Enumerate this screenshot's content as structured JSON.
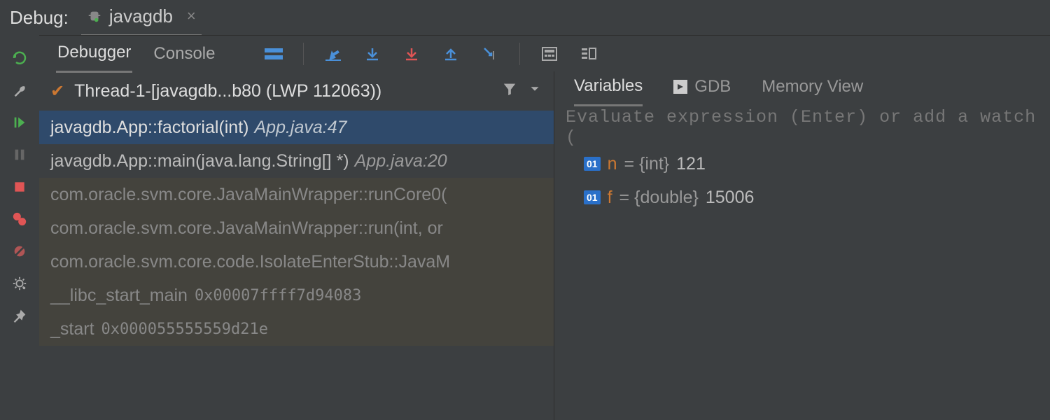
{
  "header": {
    "label": "Debug:",
    "run_config": "javagdb"
  },
  "tabs": {
    "debugger": "Debugger",
    "console": "Console"
  },
  "thread": {
    "text": "Thread-1-[javagdb...b80 (LWP 112063))"
  },
  "frames": [
    {
      "fn": "javagdb.App::factorial(int)",
      "loc": "App.java:47",
      "selected": true,
      "lib": false
    },
    {
      "fn": "javagdb.App::main(java.lang.String[] *)",
      "loc": "App.java:20",
      "selected": false,
      "lib": false
    },
    {
      "fn": "com.oracle.svm.core.JavaMainWrapper::runCore0(",
      "loc": "",
      "selected": false,
      "lib": true
    },
    {
      "fn": "com.oracle.svm.core.JavaMainWrapper::run(int, or",
      "loc": "",
      "selected": false,
      "lib": true
    },
    {
      "fn": "com.oracle.svm.core.code.IsolateEnterStub::JavaM",
      "loc": "",
      "selected": false,
      "lib": true
    },
    {
      "fn": "__libc_start_main",
      "addr": "0x00007ffff7d94083",
      "lib": true
    },
    {
      "fn": "_start",
      "addr": "0x000055555559d21e",
      "lib": true
    }
  ],
  "vars_tabs": {
    "variables": "Variables",
    "gdb": "GDB",
    "memory": "Memory View"
  },
  "eval_placeholder": "Evaluate expression (Enter) or add a watch (",
  "variables": [
    {
      "name": "n",
      "type": "int",
      "value": "121"
    },
    {
      "name": "f",
      "type": "double",
      "value": "15006"
    }
  ]
}
